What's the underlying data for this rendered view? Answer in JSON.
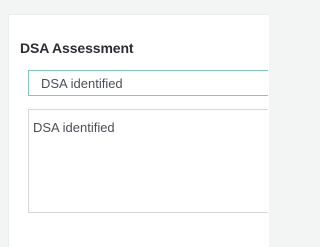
{
  "assessment": {
    "title": "DSA Assessment",
    "select_value": "DSA identified",
    "textarea_value": "DSA identified"
  },
  "colors": {
    "background": "#f3f4f4",
    "card": "#ffffff",
    "select_border": "#7fc8c2",
    "textarea_border": "#d6d9db",
    "text": "#4b5056",
    "title": "#2a2e33"
  }
}
